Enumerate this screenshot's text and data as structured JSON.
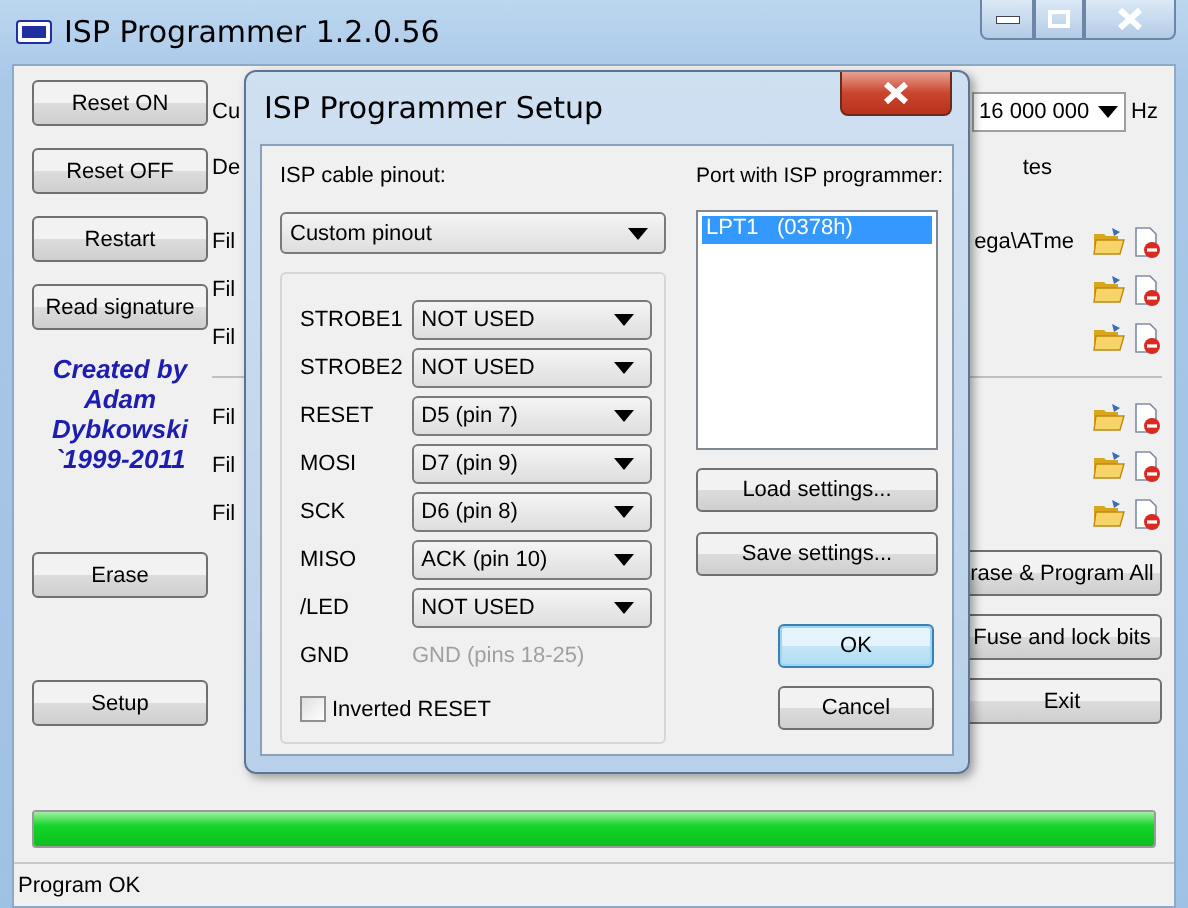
{
  "window": {
    "title": "ISP Programmer 1.2.0.56"
  },
  "left_buttons_top": [
    "Reset ON",
    "Reset OFF",
    "Restart",
    "Read signature"
  ],
  "credits": [
    "Created by",
    "Adam",
    "Dybkowski",
    "`1999-2011"
  ],
  "left_buttons_bottom": [
    "Erase",
    "Setup"
  ],
  "header_rows": [
    {
      "label": "Cu",
      "kind": "clock",
      "value": "16 000 000",
      "unit": "Hz"
    },
    {
      "label": "De",
      "kind": "text",
      "text": "tes"
    }
  ],
  "file_groups": [
    [
      {
        "label": "Fil",
        "path": "ega\\ATme"
      },
      {
        "label": "Fil"
      },
      {
        "label": "Fil"
      }
    ],
    [
      {
        "label": "Fil"
      },
      {
        "label": "Fil"
      },
      {
        "label": "Fil"
      }
    ]
  ],
  "right_buttons": [
    "rase & Program All",
    "Fuse and lock bits",
    "Exit"
  ],
  "progress": {
    "level": 1
  },
  "status_bar": "Program OK",
  "dialog": {
    "title": "ISP Programmer Setup",
    "pinout_label": "ISP cable pinout:",
    "pinout_value": "Custom pinout",
    "pins": [
      {
        "label": "STROBE1",
        "value": "NOT USED",
        "kind": "select"
      },
      {
        "label": "STROBE2",
        "value": "NOT USED",
        "kind": "select"
      },
      {
        "label": "RESET",
        "value": "D5 (pin 7)",
        "kind": "select"
      },
      {
        "label": "MOSI",
        "value": "D7 (pin 9)",
        "kind": "select"
      },
      {
        "label": "SCK",
        "value": "D6 (pin 8)",
        "kind": "select"
      },
      {
        "label": "MISO",
        "value": "ACK (pin 10)",
        "kind": "select"
      },
      {
        "label": "/LED",
        "value": "NOT USED",
        "kind": "select"
      },
      {
        "label": "GND",
        "value": "GND (pins 18-25)",
        "kind": "fixed"
      }
    ],
    "inverted_reset": {
      "label": "Inverted RESET",
      "checked": false
    },
    "port_label": "Port with ISP programmer:",
    "ports": [
      {
        "label": "LPT1   (0378h)",
        "selected": true
      }
    ],
    "buttons": [
      {
        "label": "Load settings...",
        "kind": "side"
      },
      {
        "label": "Save settings...",
        "kind": "side"
      },
      {
        "label": "OK",
        "kind": "default"
      },
      {
        "label": "Cancel",
        "kind": "plain"
      }
    ]
  }
}
